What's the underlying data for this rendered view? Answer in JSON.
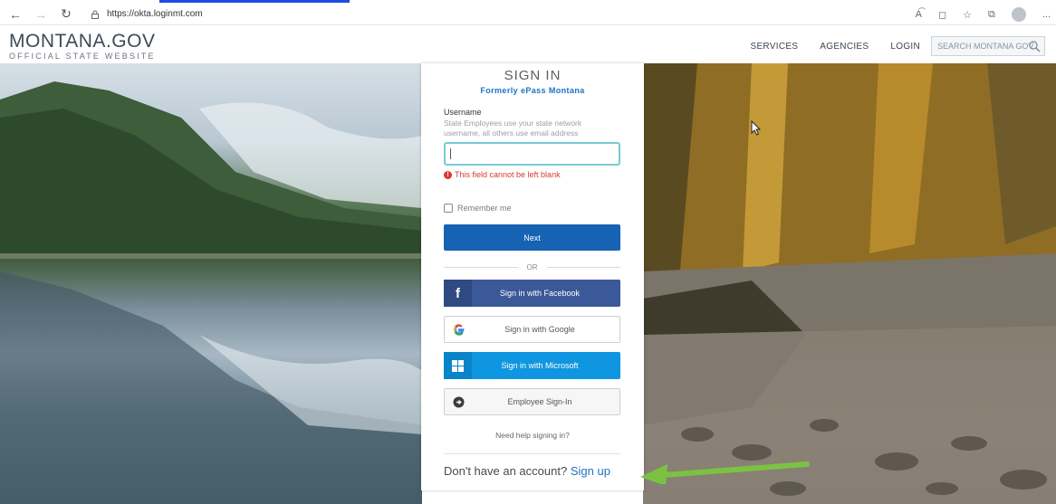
{
  "browser": {
    "url": "https://okta.loginmt.com",
    "read_aloud_icon": "A͡",
    "more_icon": "..."
  },
  "header": {
    "brand_title": "MONTANA.GOV",
    "brand_subtitle": "OFFICIAL STATE WEBSITE",
    "nav": {
      "services": "SERVICES",
      "agencies": "AGENCIES",
      "login": "LOGIN"
    },
    "search_placeholder": "SEARCH MONTANA GOV"
  },
  "signin": {
    "title": "SIGN IN",
    "subtitle": "Formerly ePass Montana",
    "username_label": "Username",
    "username_help": "State Employees use your state network username, all others use email address",
    "username_value": "",
    "error_text": "This field cannot be left blank",
    "remember_label": "Remember me",
    "remember_checked": false,
    "next_label": "Next",
    "or_label": "OR",
    "facebook_label": "Sign in with Facebook",
    "google_label": "Sign in with Google",
    "microsoft_label": "Sign in with Microsoft",
    "employee_label": "Employee Sign-In",
    "help_link": "Need help signing in?",
    "signup_prompt": "Don't have an account?",
    "signup_link": "Sign up"
  },
  "colors": {
    "primary_blue": "#1662b3",
    "facebook": "#3b5998",
    "microsoft": "#0f96e0",
    "error": "#d93934",
    "link": "#1e72c2",
    "annotation_arrow": "#7cc242"
  }
}
